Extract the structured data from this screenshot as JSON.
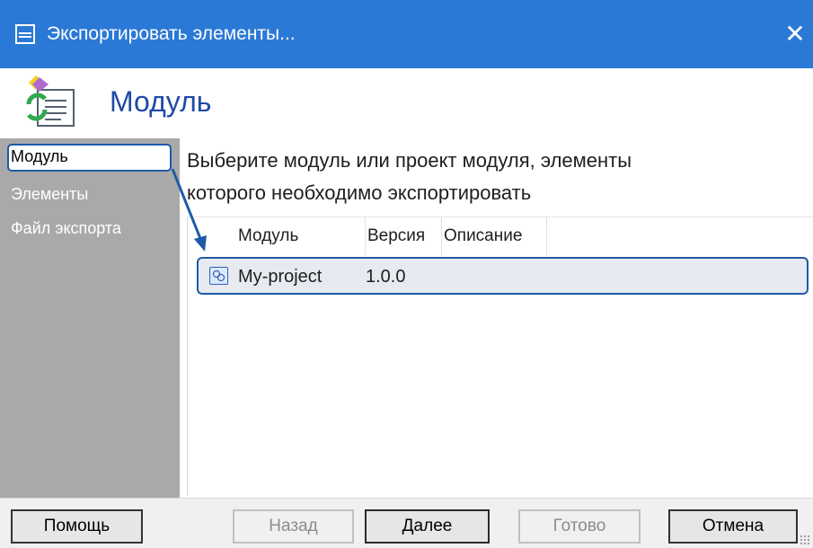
{
  "window": {
    "title": "Экспортировать элементы...",
    "close_glyph": "✕",
    "icon": "window-form-icon",
    "title_bar_color": "#2b79d6"
  },
  "header": {
    "title": "Модуль",
    "icon": "module-wizard-icon",
    "title_color": "#1f4aa8"
  },
  "sidebar": {
    "items": [
      {
        "label": "Модуль",
        "active": true
      },
      {
        "label": "Элементы",
        "active": false
      },
      {
        "label": "Файл экспорта",
        "active": false
      }
    ],
    "background": "#a9a9a9"
  },
  "main": {
    "instruction_line1": "Выберите модуль или проект модуля, элементы",
    "instruction_line2": "которого необходимо экспортировать",
    "table": {
      "columns": [
        "Модуль",
        "Версия",
        "Описание"
      ],
      "rows": [
        {
          "module": "My-project",
          "version": "1.0.0",
          "description": "",
          "icon": "module-project-icon",
          "selected": true
        }
      ]
    }
  },
  "footer": {
    "help": "Помощь",
    "back": "Назад",
    "next": "Далее",
    "finish": "Готово",
    "cancel": "Отмена"
  },
  "accent_color": "#1e5aa8"
}
